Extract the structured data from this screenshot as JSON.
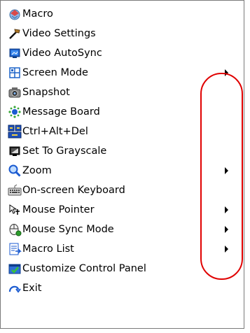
{
  "menu": {
    "items": [
      {
        "label": "Macro",
        "icon": "macro-icon",
        "submenu": false
      },
      {
        "label": "Video Settings",
        "icon": "video-settings-icon",
        "submenu": false
      },
      {
        "label": "Video AutoSync",
        "icon": "video-autosync-icon",
        "submenu": false
      },
      {
        "label": "Screen Mode",
        "icon": "screen-mode-icon",
        "submenu": true
      },
      {
        "label": "Snapshot",
        "icon": "camera-icon",
        "submenu": false
      },
      {
        "label": "Message Board",
        "icon": "message-board-icon",
        "submenu": false
      },
      {
        "label": "Ctrl+Alt+Del",
        "icon": "ctrl-alt-del-icon",
        "submenu": false
      },
      {
        "label": "Set To Grayscale",
        "icon": "grayscale-icon",
        "submenu": false
      },
      {
        "label": "Zoom",
        "icon": "magnifier-icon",
        "submenu": true
      },
      {
        "label": "On-screen Keyboard",
        "icon": "keyboard-icon",
        "submenu": false
      },
      {
        "label": "Mouse Pointer",
        "icon": "mouse-pointer-icon",
        "submenu": true
      },
      {
        "label": "Mouse Sync Mode",
        "icon": "mouse-sync-icon",
        "submenu": true
      },
      {
        "label": "Macro List",
        "icon": "macro-list-icon",
        "submenu": true
      },
      {
        "label": "Customize Control Panel",
        "icon": "customize-panel-icon",
        "submenu": false
      },
      {
        "label": "Exit",
        "icon": "exit-icon",
        "submenu": false
      }
    ]
  },
  "colors": {
    "highlight_outline": "#e00000",
    "menu_border": "#7a7a7a"
  }
}
